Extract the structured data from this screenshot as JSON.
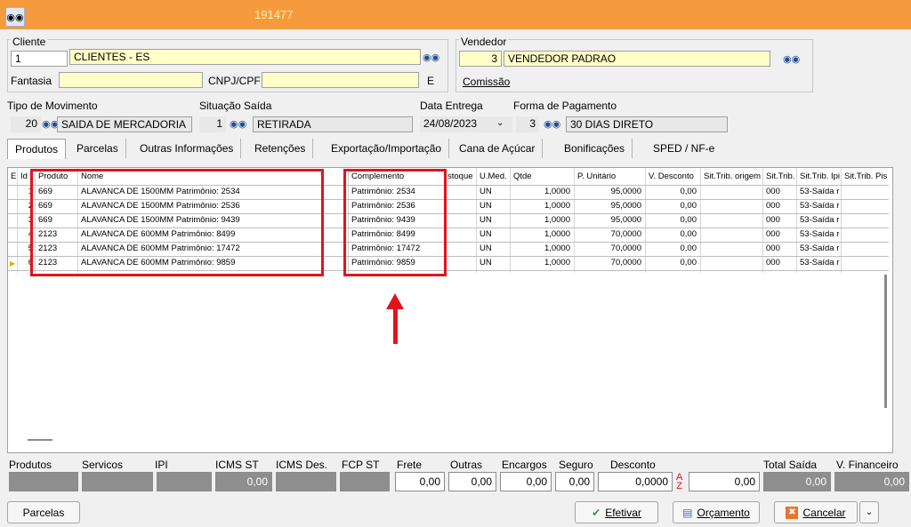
{
  "window": {
    "title_number": "191477"
  },
  "cliente": {
    "label": "Cliente",
    "code": "1",
    "name": "CLIENTES - ES",
    "fantasia_label": "Fantasia",
    "fantasia_value": "",
    "cnpj_label": "CNPJ/CPF",
    "cnpj_value": "",
    "e_label": "E"
  },
  "vendedor": {
    "label": "Vendedor",
    "code": "3",
    "name": "VENDEDOR PADRAO",
    "comissao_label": "Comissão"
  },
  "movimento": {
    "tipo_label": "Tipo  de Movimento",
    "tipo_code": "20",
    "tipo_name": "SAIDA DE MERCADORIA",
    "situacao_label": "Situação Saída",
    "situacao_code": "1",
    "situacao_name": "RETIRADA",
    "data_label": "Data Entrega",
    "data_value": "24/08/2023",
    "forma_label": "Forma de Pagamento",
    "forma_code": "3",
    "forma_name": "30 DIAS DIRETO"
  },
  "tabs": [
    "Produtos",
    "Parcelas",
    "Outras Informações",
    "Retenções",
    "Exportação/Importação",
    "Cana de Açúcar",
    "Bonificações",
    "SPED / NF-e"
  ],
  "grid": {
    "headers": {
      "e": "E",
      "id": "Id",
      "produto": "Produto",
      "nome": "Nome",
      "complemento": "Complemento",
      "estoque": "stoque",
      "umed": "U.Med.",
      "qtde": "Qtde",
      "punit": "P. Unitário",
      "vdesc": "V. Desconto",
      "sitorig": "Sit.Trib. origem",
      "sittrib": "Sit.Trib.",
      "sitipi": "Sit.Trib. Ipi",
      "sitpis": "Sit.Trib. Pis"
    },
    "rows": [
      {
        "id": "1",
        "produto": "669",
        "nome": "ALAVANCA DE 1500MM Patrimônio: 2534",
        "complemento": "Patrimônio: 2534",
        "umed": "UN",
        "qtde": "1,0000",
        "punit": "95,0000",
        "vdesc": "0,00",
        "sittrib": "000",
        "sitipi": "53-Saída r"
      },
      {
        "id": "2",
        "produto": "669",
        "nome": "ALAVANCA DE 1500MM Patrimônio: 2536",
        "complemento": "Patrimônio: 2536",
        "umed": "UN",
        "qtde": "1,0000",
        "punit": "95,0000",
        "vdesc": "0,00",
        "sittrib": "000",
        "sitipi": "53-Saída r"
      },
      {
        "id": "3",
        "produto": "669",
        "nome": "ALAVANCA DE 1500MM Patrimônio: 9439",
        "complemento": "Patrimônio: 9439",
        "umed": "UN",
        "qtde": "1,0000",
        "punit": "95,0000",
        "vdesc": "0,00",
        "sittrib": "000",
        "sitipi": "53-Saída r"
      },
      {
        "id": "4",
        "produto": "2123",
        "nome": "ALAVANCA DE 600MM Patrimônio: 8499",
        "complemento": "Patrimônio: 8499",
        "umed": "UN",
        "qtde": "1,0000",
        "punit": "70,0000",
        "vdesc": "0,00",
        "sittrib": "000",
        "sitipi": "53-Saída r"
      },
      {
        "id": "5",
        "produto": "2123",
        "nome": "ALAVANCA DE 600MM Patrimônio: 17472",
        "complemento": "Patrimônio: 17472",
        "umed": "UN",
        "qtde": "1,0000",
        "punit": "70,0000",
        "vdesc": "0,00",
        "sittrib": "000",
        "sitipi": "53-Saída r"
      },
      {
        "id": "6",
        "produto": "2123",
        "nome": "ALAVANCA DE 600MM Patrimônio: 9859",
        "complemento": "Patrimônio: 9859",
        "umed": "UN",
        "qtde": "1,0000",
        "punit": "70,0000",
        "vdesc": "0,00",
        "sittrib": "000",
        "sitipi": "53-Saída r"
      }
    ]
  },
  "totals": {
    "labels": {
      "produtos": "Produtos",
      "servicos": "Servicos",
      "ipi": "IPI",
      "icms_st": "ICMS ST",
      "icms_des": "ICMS Des.",
      "fcp_st": "FCP ST",
      "frete": "Frete",
      "outras": "Outras",
      "encargos": "Encargos",
      "seguro": "Seguro",
      "desconto": "Desconto",
      "total_saida": "Total Saída",
      "v_financeiro": "V. Financeiro"
    },
    "values": {
      "icms_st": "0,00",
      "frete": "0,00",
      "outras": "0,00",
      "encargos": "0,00",
      "seguro": "0,00",
      "desconto_pct": "0,0000",
      "desconto": "0,00",
      "total_saida": "0,00",
      "v_financeiro": "0,00"
    }
  },
  "buttons": {
    "parcelas": "Parcelas",
    "efetivar": "Efetivar",
    "orcamento": "Orçamento",
    "cancelar": "Cancelar"
  },
  "colors": {
    "titlebar": "#f59a3d",
    "highlight": "#e0141e",
    "lookup_field": "#ffffc8"
  }
}
